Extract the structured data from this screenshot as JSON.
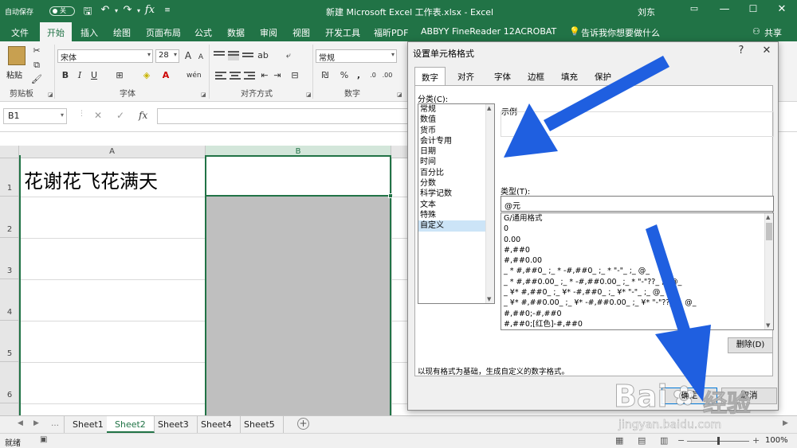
{
  "titlebar": {
    "autosave_label": "自动保存",
    "autosave_state": "关",
    "doc_title": "新建 Microsoft Excel 工作表.xlsx  -  Excel",
    "user": "刘东"
  },
  "ribbon_tabs": [
    "文件",
    "开始",
    "插入",
    "绘图",
    "页面布局",
    "公式",
    "数据",
    "审阅",
    "视图",
    "开发工具",
    "福昕PDF",
    "ABBYY FineReader 12",
    "ACROBAT"
  ],
  "tell_me": "告诉我你想要做什么",
  "share": "共享",
  "ribbon": {
    "paste_label": "粘贴",
    "clipboard_group": "剪贴板",
    "font_name": "宋体",
    "font_size": "28",
    "font_group": "字体",
    "align_group": "对齐方式",
    "number_format": "常规",
    "number_group": "数字"
  },
  "formula_bar": {
    "name_box": "B1",
    "fx": "fx"
  },
  "grid": {
    "columns": [
      "A",
      "B"
    ],
    "rows": [
      "1",
      "2",
      "3",
      "4",
      "5",
      "6"
    ],
    "a1_value": "花谢花飞花满天"
  },
  "sheets": [
    "Sheet1",
    "Sheet2",
    "Sheet3",
    "Sheet4",
    "Sheet5"
  ],
  "active_sheet": "Sheet2",
  "status": {
    "ready": "就绪",
    "zoom": "100%"
  },
  "dialog": {
    "title": "设置单元格格式",
    "help": "?",
    "close": "✕",
    "tabs": [
      "数字",
      "对齐",
      "字体",
      "边框",
      "填充",
      "保护"
    ],
    "category_label": "分类(C):",
    "categories": [
      "常规",
      "数值",
      "货币",
      "会计专用",
      "日期",
      "时间",
      "百分比",
      "分数",
      "科学记数",
      "文本",
      "特殊",
      "自定义"
    ],
    "selected_category": "自定义",
    "sample_label": "示例",
    "type_label": "类型(T):",
    "type_value": "@元",
    "formats": [
      "G/通用格式",
      "0",
      "0.00",
      "#,##0",
      "#,##0.00",
      "_ * #,##0_ ;_ * -#,##0_ ;_ * \"-\"_ ;_ @_",
      "_ * #,##0.00_ ;_ * -#,##0.00_ ;_ * \"-\"??_ ;_ @_",
      "_ ¥* #,##0_ ;_ ¥* -#,##0_ ;_ ¥* \"-\"_ ;_ @_",
      "_ ¥* #,##0.00_ ;_ ¥* -#,##0.00_ ;_ ¥* \"-\"??_ ;_ @_",
      "#,##0;-#,##0",
      "#,##0;[红色]-#,##0"
    ],
    "delete_button": "删除(D)",
    "description": "以现有格式为基础，生成自定义的数字格式。",
    "ok_button": "确定",
    "cancel_button": "取消"
  },
  "watermark": {
    "brand": "Bai",
    "brand2": "经验",
    "url": "jingyan.baidu.com"
  },
  "colors": {
    "excel_green": "#217346",
    "arrow_blue": "#1f5fe0"
  }
}
